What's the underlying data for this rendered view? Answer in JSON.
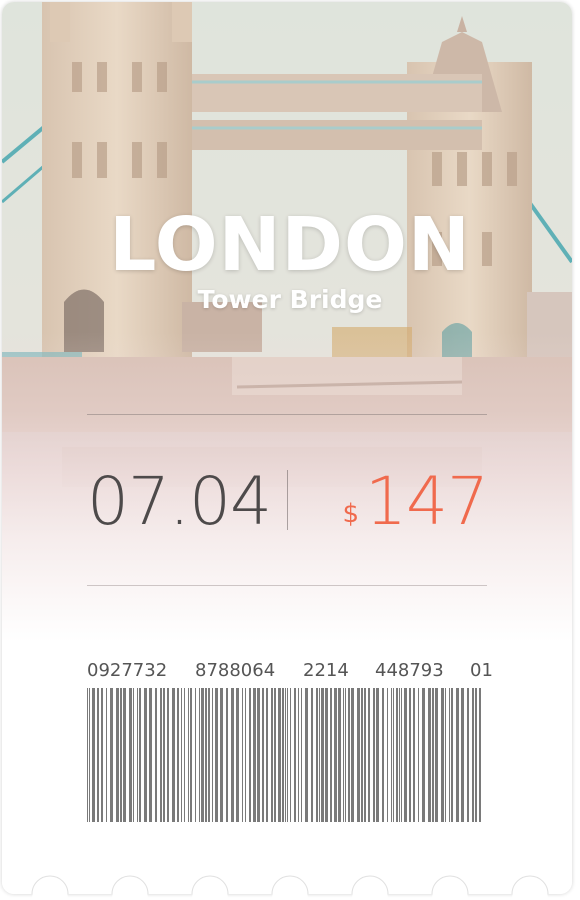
{
  "ticket": {
    "city": "LONDON",
    "landmark": "Tower Bridge",
    "date": "07.04",
    "currency": "$",
    "price": "147"
  },
  "barcode": {
    "digit_groups": [
      "0927732",
      "8788064",
      "2214",
      "448793",
      "01"
    ]
  },
  "colors": {
    "accent": "#f06a4d",
    "text_dark": "#4d4a4a",
    "barcode": "#7a7a7a"
  }
}
